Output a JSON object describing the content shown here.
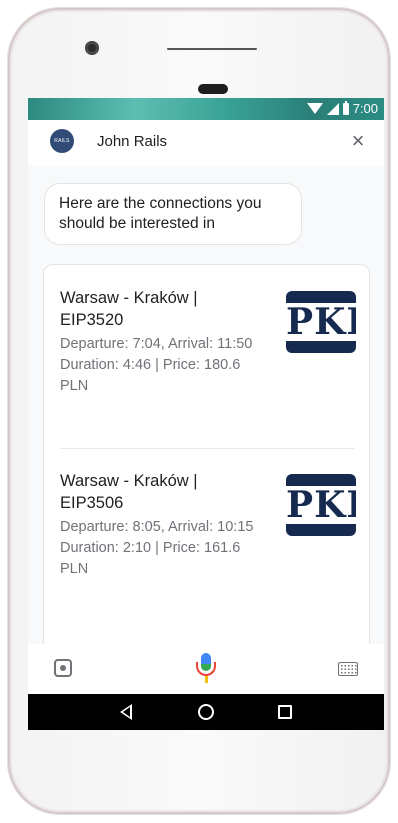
{
  "status_bar": {
    "time": "7:00",
    "icons": [
      "wifi-icon",
      "signal-icon",
      "battery-icon"
    ]
  },
  "header": {
    "avatar_text": "RAILS",
    "title": "John Rails",
    "close_icon": "close-icon",
    "close_glyph": "×"
  },
  "chat": {
    "bot_message": "Here are the connections you should be interested in",
    "connections": [
      {
        "title": "Warsaw - Kraków | EIP3520",
        "departure": "Departure: 7:04, Arrival: 11:50",
        "duration": "Duration: 4:46 | Price: 180.6 PLN",
        "logo_text": "PKP"
      },
      {
        "title": "Warsaw - Kraków | EIP3506",
        "departure": "Departure: 8:05, Arrival: 10:15",
        "duration": "Duration: 2:10 | Price: 161.6 PLN",
        "logo_text": "PKP"
      }
    ]
  },
  "input_bar": {
    "icons": [
      "lens-icon",
      "microphone-icon",
      "keyboard-icon"
    ]
  },
  "nav_bar": {
    "icons": [
      "back-icon",
      "home-icon",
      "recents-icon"
    ]
  },
  "colors": {
    "status_bar": "#2c8a80",
    "avatar": "#2f4b76",
    "pkp_blue": "#16294f",
    "mic_blue": "#4285f4",
    "mic_red": "#ea4335",
    "mic_green": "#34a853",
    "mic_yellow": "#fbbc05"
  }
}
